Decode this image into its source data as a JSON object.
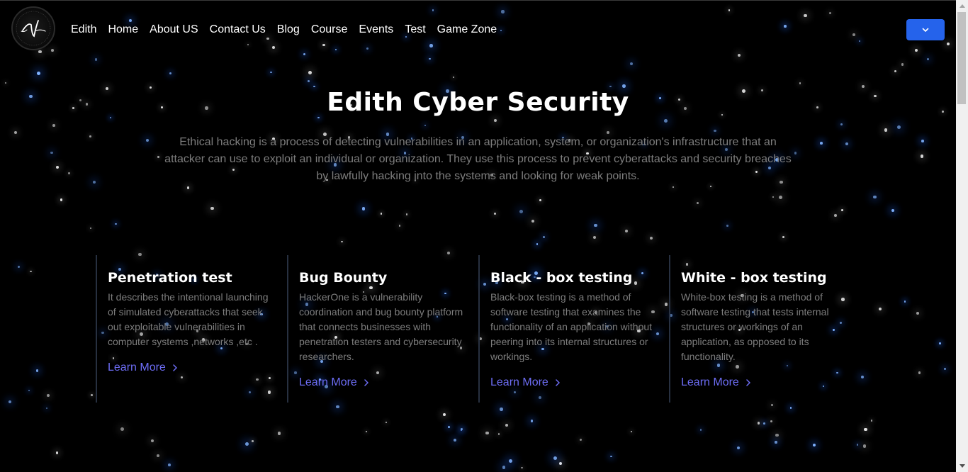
{
  "nav": {
    "brand": "Edith",
    "links": [
      "Home",
      "About US",
      "Contact Us",
      "Blog",
      "Course",
      "Events",
      "Test",
      "Game Zone"
    ]
  },
  "hero": {
    "title": "Edith Cyber Security",
    "description": "Ethical hacking is a process of detecting vulnerabilities in an application, system, or organization's infrastructure that an attacker can use to exploit an individual or organization. They use this process to prevent cyberattacks and security breaches by lawfully hacking into the systems and looking for weak points."
  },
  "features": [
    {
      "title": "Penetration test",
      "text": "It describes the intentional launching of simulated cyberattacks that seek out exploitable vulnerabilities in computer systems ,networks ,etc .",
      "link": "Learn More"
    },
    {
      "title": "Bug Bounty",
      "text": "HackerOne is a vulnerability coordination and bug bounty platform that connects businesses with penetration testers and cybersecurity researchers.",
      "link": "Learn More"
    },
    {
      "title": "Black - box testing",
      "text": "Black-box testing is a method of software testing that examines the functionality of an application without peering into its internal structures or workings.",
      "link": "Learn More"
    },
    {
      "title": "White - box testing",
      "text": "White-box testing is a method of software testing that tests internal structures or workings of an application, as opposed to its functionality.",
      "link": "Learn More"
    }
  ],
  "colors": {
    "background": "#000000",
    "accent": "#2563eb",
    "link": "#6d6df5",
    "muted_text": "#7d7d7d"
  },
  "icons": [
    "logo-emblem",
    "chevron-down-icon",
    "chevron-right-icon"
  ]
}
